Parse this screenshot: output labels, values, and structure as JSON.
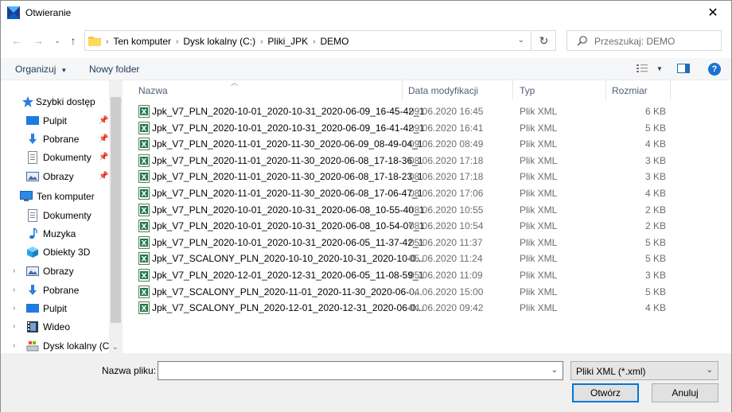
{
  "window": {
    "title": "Otwieranie"
  },
  "address": {
    "crumbs": [
      "Ten komputer",
      "Dysk lokalny (C:)",
      "Pliki_JPK",
      "DEMO"
    ]
  },
  "search": {
    "placeholder": "Przeszukaj: DEMO"
  },
  "toolbar": {
    "organize_label": "Organizuj",
    "new_folder_label": "Nowy folder"
  },
  "sidebar": {
    "items": [
      {
        "label": "Szybki dostęp",
        "icon": "star-icon"
      },
      {
        "label": "Pulpit",
        "icon": "desktop-icon"
      },
      {
        "label": "Pobrane",
        "icon": "download-icon"
      },
      {
        "label": "Dokumenty",
        "icon": "documents-icon"
      },
      {
        "label": "Obrazy",
        "icon": "pictures-icon"
      },
      {
        "label": "Ten komputer",
        "icon": "computer-icon"
      },
      {
        "label": "Dokumenty",
        "icon": "documents-icon"
      },
      {
        "label": "Muzyka",
        "icon": "music-icon"
      },
      {
        "label": "Obiekty 3D",
        "icon": "objects3d-icon"
      },
      {
        "label": "Obrazy",
        "icon": "pictures-icon"
      },
      {
        "label": "Pobrane",
        "icon": "download-icon"
      },
      {
        "label": "Pulpit",
        "icon": "desktop-icon"
      },
      {
        "label": "Wideo",
        "icon": "video-icon"
      },
      {
        "label": "Dysk lokalny (C:)",
        "icon": "drive-icon"
      }
    ]
  },
  "columns": {
    "name": "Nazwa",
    "date": "Data modyfikacji",
    "type": "Typ",
    "size": "Rozmiar"
  },
  "files": [
    {
      "name": "Jpk_V7_PLN_2020-10-01_2020-10-31_2020-06-09_16-45-42_1",
      "date": "09.06.2020 16:45",
      "type": "Plik XML",
      "size": "6 KB"
    },
    {
      "name": "Jpk_V7_PLN_2020-10-01_2020-10-31_2020-06-09_16-41-42_1",
      "date": "09.06.2020 16:41",
      "type": "Plik XML",
      "size": "5 KB"
    },
    {
      "name": "Jpk_V7_PLN_2020-11-01_2020-11-30_2020-06-09_08-49-04_1",
      "date": "09.06.2020 08:49",
      "type": "Plik XML",
      "size": "4 KB"
    },
    {
      "name": "Jpk_V7_PLN_2020-11-01_2020-11-30_2020-06-08_17-18-36_1",
      "date": "08.06.2020 17:18",
      "type": "Plik XML",
      "size": "3 KB"
    },
    {
      "name": "Jpk_V7_PLN_2020-11-01_2020-11-30_2020-06-08_17-18-23_1",
      "date": "08.06.2020 17:18",
      "type": "Plik XML",
      "size": "3 KB"
    },
    {
      "name": "Jpk_V7_PLN_2020-11-01_2020-11-30_2020-06-08_17-06-47_1",
      "date": "08.06.2020 17:06",
      "type": "Plik XML",
      "size": "4 KB"
    },
    {
      "name": "Jpk_V7_PLN_2020-10-01_2020-10-31_2020-06-08_10-55-40_1",
      "date": "08.06.2020 10:55",
      "type": "Plik XML",
      "size": "2 KB"
    },
    {
      "name": "Jpk_V7_PLN_2020-10-01_2020-10-31_2020-06-08_10-54-07_1",
      "date": "08.06.2020 10:54",
      "type": "Plik XML",
      "size": "2 KB"
    },
    {
      "name": "Jpk_V7_PLN_2020-10-01_2020-10-31_2020-06-05_11-37-42_1",
      "date": "05.06.2020 11:37",
      "type": "Plik XML",
      "size": "5 KB"
    },
    {
      "name": "Jpk_V7_SCALONY_PLN_2020-10-10_2020-10-31_2020-10-0...",
      "date": "05.06.2020 11:24",
      "type": "Plik XML",
      "size": "5 KB"
    },
    {
      "name": "Jpk_V7_PLN_2020-12-01_2020-12-31_2020-06-05_11-08-59_1",
      "date": "05.06.2020 11:09",
      "type": "Plik XML",
      "size": "3 KB"
    },
    {
      "name": "Jpk_V7_SCALONY_PLN_2020-11-01_2020-11-30_2020-06-0...",
      "date": "04.06.2020 15:00",
      "type": "Plik XML",
      "size": "5 KB"
    },
    {
      "name": "Jpk_V7_SCALONY_PLN_2020-12-01_2020-12-31_2020-06-0...",
      "date": "04.06.2020 09:42",
      "type": "Plik XML",
      "size": "4 KB"
    }
  ],
  "footer": {
    "filename_label": "Nazwa pliku:",
    "filename_value": "",
    "filter_value": "Pliki XML (*.xml)",
    "open_label": "Otwórz",
    "cancel_label": "Anuluj"
  }
}
